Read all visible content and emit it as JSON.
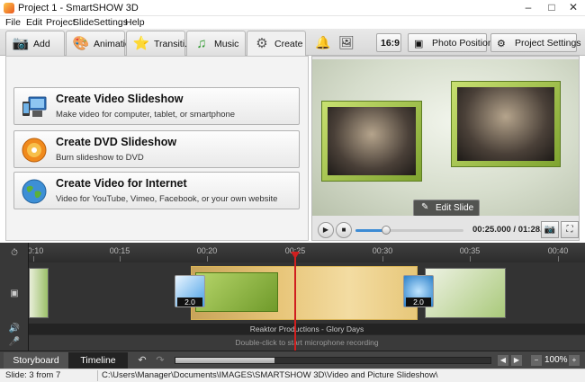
{
  "window": {
    "title": "Project 1 - SmartSHOW 3D",
    "min_glyph": "–",
    "max_glyph": "□",
    "close_glyph": "✕"
  },
  "menu": [
    "File",
    "Edit",
    "Project",
    "Slide",
    "Settings",
    "Help"
  ],
  "tabs": [
    {
      "label": "Add",
      "icon": "camera-icon",
      "glyph": "📷"
    },
    {
      "label": "Animation",
      "icon": "palette-icon",
      "glyph": "🎨"
    },
    {
      "label": "Transiti...",
      "icon": "star-icon",
      "glyph": "⭐"
    },
    {
      "label": "Music",
      "icon": "music-note-icon",
      "glyph": "♫"
    },
    {
      "label": "Create",
      "icon": "film-reel-icon",
      "glyph": "⚙",
      "active": true
    }
  ],
  "toolbar_right": {
    "aspect_label": "16:9",
    "photo_position_label": "Photo Position",
    "project_settings_label": "Project Settings"
  },
  "create_options": [
    {
      "title": "Create Video Slideshow",
      "subtitle": "Make video for computer, tablet, or smartphone",
      "icon": "devices-icon"
    },
    {
      "title": "Create DVD Slideshow",
      "subtitle": "Burn slideshow to DVD",
      "icon": "dvd-icon"
    },
    {
      "title": "Create Video for Internet",
      "subtitle": "Video for YouTube, Vimeo, Facebook, or your own website",
      "icon": "globe-icon"
    }
  ],
  "preview": {
    "edit_slide_label": "Edit Slide",
    "time_current": "00:25.000",
    "time_total": "01:28.000",
    "time_separator": " / ",
    "playback_fraction": 0.28
  },
  "timeline": {
    "ticks": [
      "00:10",
      "00:15",
      "00:20",
      "00:25",
      "00:30",
      "00:35",
      "00:40"
    ],
    "transitions": [
      {
        "duration": "2.0"
      },
      {
        "duration": "2.0"
      }
    ],
    "audio_label": "Reaktor Productions - Glory Days",
    "mic_label": "Double-click to start microphone recording"
  },
  "bottom": {
    "storyboard_label": "Storyboard",
    "timeline_label": "Timeline",
    "zoom": "100%"
  },
  "status": {
    "slide_info": "Slide: 3 from 7",
    "path": "C:\\Users\\Manager\\Documents\\IMAGES\\SMARTSHOW 3D\\Video and Picture Slideshow\\"
  },
  "colors": {
    "playhead": "#d01f1f",
    "frame_green": "#8fb83a"
  }
}
